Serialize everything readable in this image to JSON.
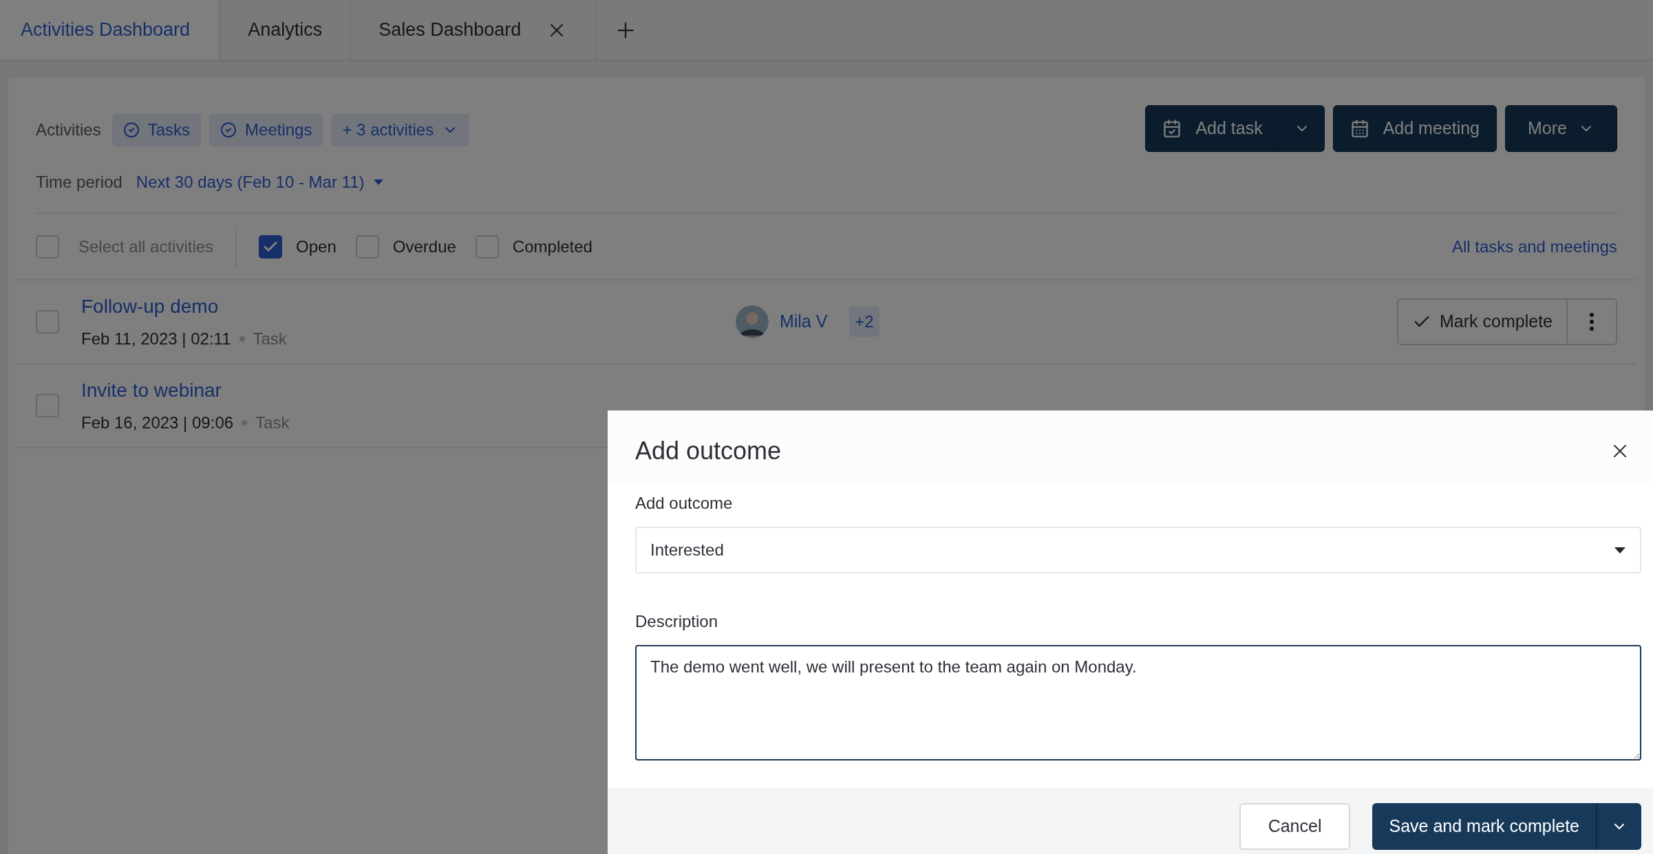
{
  "tabs": [
    {
      "label": "Activities Dashboard",
      "selected": true,
      "closable": false
    },
    {
      "label": "Analytics",
      "selected": false,
      "closable": false
    },
    {
      "label": "Sales Dashboard",
      "selected": false,
      "closable": true
    }
  ],
  "filters": {
    "label": "Activities",
    "chips": [
      {
        "kind": "check",
        "label": "Tasks"
      },
      {
        "kind": "check",
        "label": "Meetings"
      },
      {
        "kind": "dropdown",
        "label": "+ 3 activities"
      }
    ]
  },
  "actions": [
    {
      "kind": "split",
      "label": "Add task"
    },
    {
      "kind": "calendar",
      "label": "Add meeting"
    },
    {
      "kind": "menu",
      "label": "More"
    }
  ],
  "time_period": {
    "label": "Time period",
    "value": "Next 30 days (Feb 10 - Mar 11)"
  },
  "select_all": {
    "label": "Select all activities",
    "checked": false
  },
  "status_filters": [
    {
      "label": "Open",
      "checked": true
    },
    {
      "label": "Overdue",
      "checked": false
    },
    {
      "label": "Completed",
      "checked": false
    }
  ],
  "all_link": "All tasks and meetings",
  "activities": [
    {
      "title": "Follow-up demo",
      "date": "Feb 11, 2023 | 02:11",
      "type": "Task",
      "checked": false,
      "assignee": "Mila V",
      "extra": "+2",
      "action": "Mark complete"
    },
    {
      "title": "Invite to webinar",
      "date": "Feb 16, 2023 | 09:06",
      "type": "Task",
      "checked": false
    }
  ],
  "dialog": {
    "title": "Add outcome",
    "outcome_label": "Add outcome",
    "outcome_value": "Interested",
    "description_label": "Description",
    "description_value": "The demo went well, we will present to the team again on Monday.",
    "cancel": "Cancel",
    "save": "Save and mark complete"
  }
}
